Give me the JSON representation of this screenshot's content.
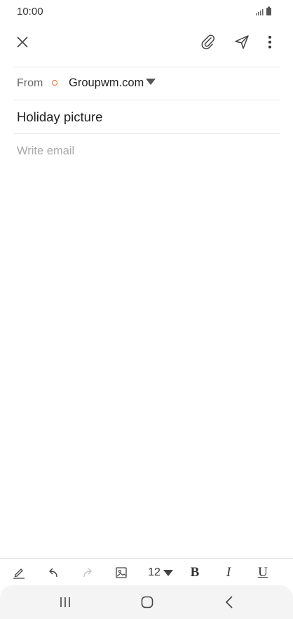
{
  "status_bar": {
    "time": "10:00"
  },
  "header": {
    "close_icon": "close-icon",
    "attach_icon": "paperclip-icon",
    "send_icon": "send-icon",
    "more_icon": "more-vert-icon"
  },
  "compose": {
    "from_label": "From",
    "from_account": "Groupwm.com",
    "subject": "Holiday picture",
    "body_placeholder": "Write email"
  },
  "format_toolbar": {
    "font_size": "12",
    "bold": "B",
    "italic": "I",
    "underline": "U"
  },
  "colors": {
    "accent_dot": "#e8703a"
  }
}
